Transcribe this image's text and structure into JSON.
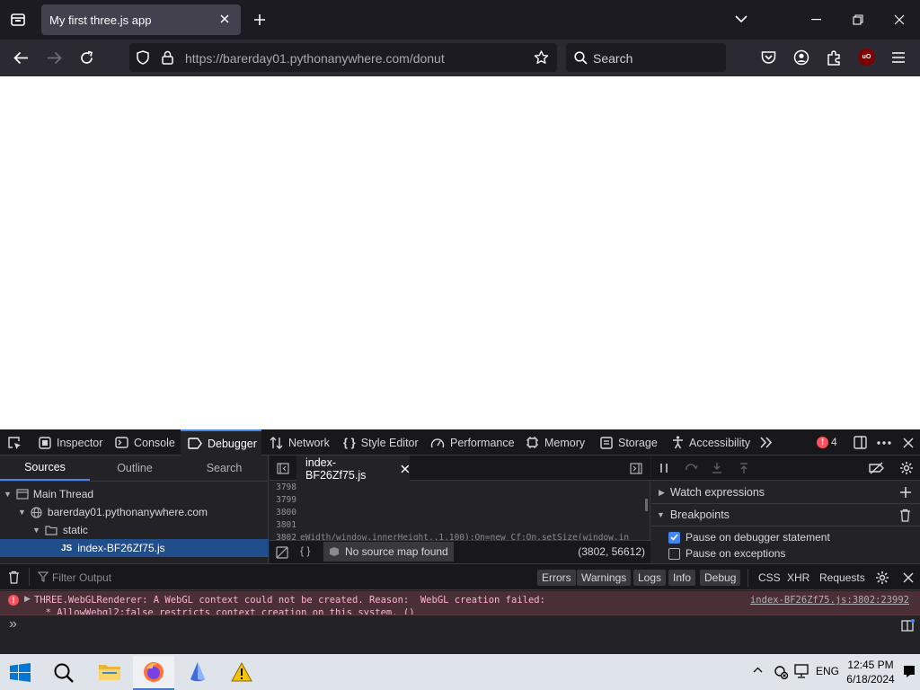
{
  "browser": {
    "tab_title": "My first three.js app",
    "url_host": "https://barerday01.pythonanywhere.com",
    "url_path": "/donut",
    "search_placeholder": "Search",
    "extension_badge": "uO"
  },
  "devtools": {
    "tabs": [
      "Inspector",
      "Console",
      "Debugger",
      "Network",
      "Style Editor",
      "Performance",
      "Memory",
      "Storage",
      "Accessibility"
    ],
    "active_tab": "Debugger",
    "error_count": "4",
    "sources": {
      "tabs": [
        "Sources",
        "Outline",
        "Search"
      ],
      "tree": [
        "Main Thread",
        "barerday01.pythonanywhere.com",
        "static",
        "index-BF26Zf75.js"
      ]
    },
    "editor": {
      "file_tab": "index-BF26Zf75.js",
      "line_numbers": [
        "3798",
        "3799",
        "3800",
        "3801",
        "3802"
      ],
      "code_snippet": "eWidth/window.innerHeight,.1,100);On=new Cf;On.setSize(window.in",
      "source_map_status": "No source map found",
      "cursor_position": "(3802, 56612)"
    },
    "right_pane": {
      "watch_label": "Watch expressions",
      "breakpoints_label": "Breakpoints",
      "pause_debugger": "Pause on debugger statement",
      "pause_debugger_checked": true,
      "pause_exceptions": "Pause on exceptions",
      "pause_exceptions_checked": false
    },
    "console": {
      "filter_placeholder": "Filter Output",
      "filters": [
        "Errors",
        "Warnings",
        "Logs",
        "Info",
        "Debug"
      ],
      "extra_filters": [
        "CSS",
        "XHR",
        "Requests"
      ],
      "error_line1": "THREE.WebGLRenderer: A WebGL context could not be created. Reason:  WebGL creation failed:",
      "error_line2": "  * AllowWebgl2:false restricts context creation on this system. ()",
      "error_location": "index-BF26Zf75.js:3802:23992",
      "prompt": "»"
    }
  },
  "taskbar": {
    "language": "ENG",
    "time": "12:45 PM",
    "date": "6/18/2024"
  }
}
